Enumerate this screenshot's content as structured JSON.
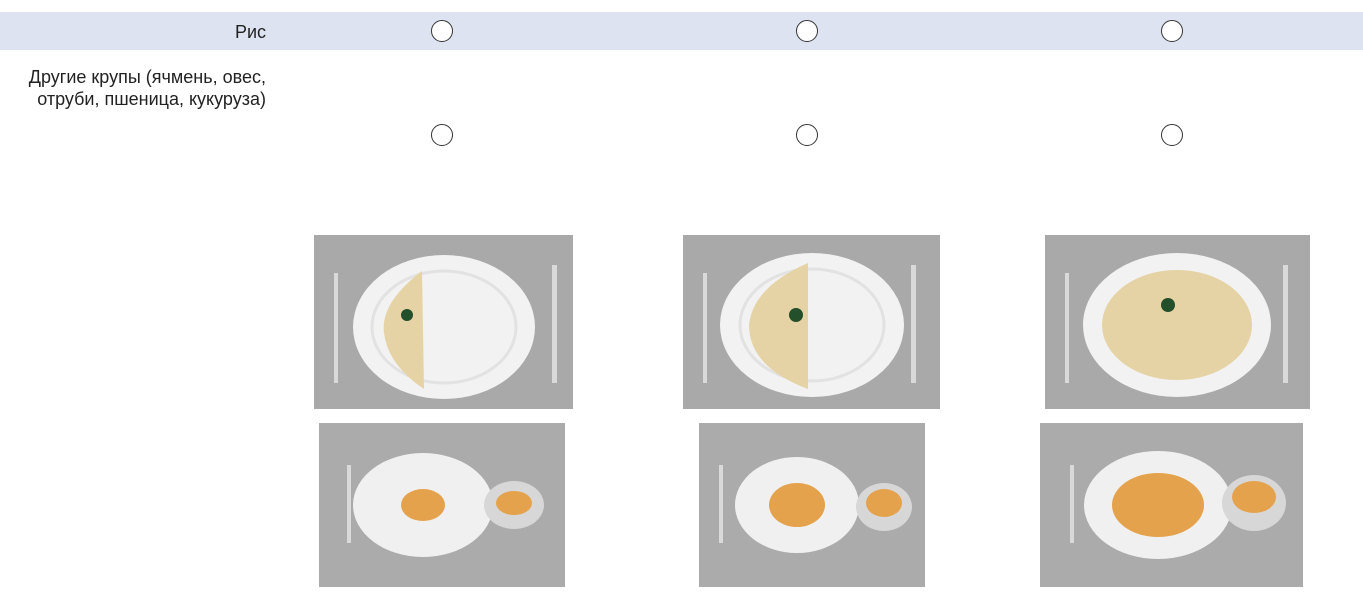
{
  "rows": [
    {
      "label": "Рис",
      "options": [
        "small-portion",
        "medium-portion",
        "large-portion"
      ]
    },
    {
      "label": "Другие крупы (ячмень, овес, отруби, пшеница, кукуруза)",
      "options": [
        "small-portion",
        "medium-portion",
        "large-portion"
      ]
    }
  ],
  "colors": {
    "row_band": "#dde3f1",
    "background": "#ffffff",
    "tablecloth": "#a9a9a9",
    "plate": "#f2f2f2",
    "rice": "#e6d3a5",
    "cereal": "#e5a24c",
    "broccoli": "#234f2a"
  },
  "images": [
    {
      "name": "rice-plate-small",
      "fill": "small"
    },
    {
      "name": "rice-plate-medium",
      "fill": "medium"
    },
    {
      "name": "rice-plate-large",
      "fill": "large"
    },
    {
      "name": "cereal-bowl-small",
      "fill": "small"
    },
    {
      "name": "cereal-bowl-medium",
      "fill": "medium"
    },
    {
      "name": "cereal-bowl-large",
      "fill": "large"
    }
  ]
}
